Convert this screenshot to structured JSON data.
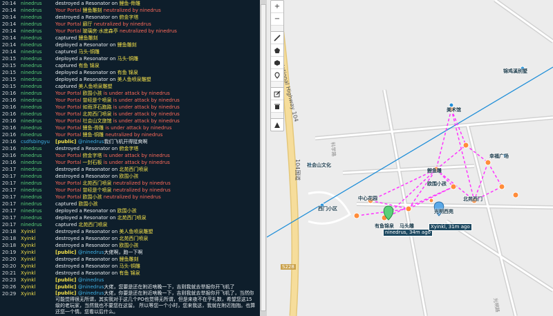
{
  "comm": {
    "rows": [
      {
        "time": "20:14",
        "player": "ninedrus",
        "pcolor": "green",
        "kind": "plain",
        "text": "destroyed a Resonator on ",
        "portal": "鲤鱼-骨雕"
      },
      {
        "time": "20:14",
        "player": "ninedrus",
        "pcolor": "green",
        "kind": "red",
        "text": "Your Portal ",
        "portal": "鲤鱼雕刻",
        "tail": " neutralized by ninedrus"
      },
      {
        "time": "20:14",
        "player": "ninedrus",
        "pcolor": "green",
        "kind": "plain",
        "text": "destroyed a Resonator on ",
        "portal": "俯金字塔"
      },
      {
        "time": "20:14",
        "player": "ninedrus",
        "pcolor": "green",
        "kind": "red",
        "text": "Your Portal ",
        "portal": "廊厅",
        "tail": " neutralized by ninedrus"
      },
      {
        "time": "20:14",
        "player": "ninedrus",
        "pcolor": "green",
        "kind": "red",
        "text": "Your Portal ",
        "portal": "玻璃房·水底森亭",
        "tail": " neutralized by ninedrus"
      },
      {
        "time": "20:14",
        "player": "ninedrus",
        "pcolor": "green",
        "kind": "plain",
        "text": "captured ",
        "portal": "鲤鱼雕刻"
      },
      {
        "time": "20:14",
        "player": "ninedrus",
        "pcolor": "green",
        "kind": "plain",
        "text": "deployed a Resonator on ",
        "portal": "鲤鱼雕刻"
      },
      {
        "time": "20:14",
        "player": "ninedrus",
        "pcolor": "green",
        "kind": "plain",
        "text": "captured ",
        "portal": "马头-铜雕"
      },
      {
        "time": "20:15",
        "player": "ninedrus",
        "pcolor": "green",
        "kind": "plain",
        "text": "deployed a Resonator on ",
        "portal": "马头-铜雕"
      },
      {
        "time": "20:15",
        "player": "ninedrus",
        "pcolor": "green",
        "kind": "plain",
        "text": "captured ",
        "portal": "有鱼 锦泉"
      },
      {
        "time": "20:15",
        "player": "ninedrus",
        "pcolor": "green",
        "kind": "plain",
        "text": "deployed a Resonator on ",
        "portal": "有鱼 锦泉"
      },
      {
        "time": "20:15",
        "player": "ninedrus",
        "pcolor": "green",
        "kind": "plain",
        "text": "deployed a Resonator on ",
        "portal": "美人鱼喷泉雕塑"
      },
      {
        "time": "20:15",
        "player": "ninedrus",
        "pcolor": "green",
        "kind": "plain",
        "text": "captured ",
        "portal": "美人鱼喷泉雕塑"
      },
      {
        "time": "20:16",
        "player": "ninedrus",
        "pcolor": "green",
        "kind": "red",
        "text": "Your Portal ",
        "portal": "欧围小孩",
        "tail": " is under attack by ninedrus"
      },
      {
        "time": "20:16",
        "player": "ninedrus",
        "pcolor": "green",
        "kind": "red",
        "text": "Your Portal ",
        "portal": "曾经是个喷泉",
        "tail": " is under attack by ninedrus"
      },
      {
        "time": "20:16",
        "player": "ninedrus",
        "pcolor": "green",
        "kind": "red",
        "text": "Your Portal ",
        "portal": "如雨浮石跑路",
        "tail": " is under attack by ninedrus"
      },
      {
        "time": "20:16",
        "player": "ninedrus",
        "pcolor": "green",
        "kind": "red",
        "text": "Your Portal ",
        "portal": "北苑西门喷泉",
        "tail": " is under attack by ninedrus"
      },
      {
        "time": "20:16",
        "player": "ninedrus",
        "pcolor": "green",
        "kind": "red",
        "text": "Your Portal ",
        "portal": "社会山文旅馆",
        "tail": " is under attack by ninedrus"
      },
      {
        "time": "20:16",
        "player": "ninedrus",
        "pcolor": "green",
        "kind": "red",
        "text": "Your Portal ",
        "portal": "鲤鱼-骨雕",
        "tail": " is under attack by ninedrus"
      },
      {
        "time": "20:16",
        "player": "ninedrus",
        "pcolor": "green",
        "kind": "red",
        "text": "Your Portal ",
        "portal": "鲤鱼-铜雕",
        "tail": " neutralized by ninedrus"
      },
      {
        "time": "20:16",
        "player": "csdfsbingyu",
        "pcolor": "blue",
        "kind": "public",
        "text": "我们飞机开得挺爽啊",
        "at": "@ninedrus"
      },
      {
        "time": "20:16",
        "player": "ninedrus",
        "pcolor": "green",
        "kind": "plain",
        "text": "destroyed a Resonator on ",
        "portal": "俯金字塔"
      },
      {
        "time": "20:16",
        "player": "ninedrus",
        "pcolor": "green",
        "kind": "red",
        "text": "Your Portal ",
        "portal": "俯金字塔",
        "tail": " is under attack by ninedrus"
      },
      {
        "time": "20:16",
        "player": "ninedrus",
        "pcolor": "green",
        "kind": "red",
        "text": "Your Portal ",
        "portal": "一封石板",
        "tail": " is under attack by ninedrus"
      },
      {
        "time": "20:17",
        "player": "ninedrus",
        "pcolor": "green",
        "kind": "plain",
        "text": "destroyed a Resonator on ",
        "portal": "北苑西门喷泉"
      },
      {
        "time": "20:17",
        "player": "ninedrus",
        "pcolor": "green",
        "kind": "plain",
        "text": "destroyed a Resonator on ",
        "portal": "欧围小孩"
      },
      {
        "time": "20:17",
        "player": "ninedrus",
        "pcolor": "green",
        "kind": "red",
        "text": "Your Portal ",
        "portal": "北苑西门喷泉",
        "tail": " neutralized by ninedrus"
      },
      {
        "time": "20:17",
        "player": "ninedrus",
        "pcolor": "green",
        "kind": "red",
        "text": "Your Portal ",
        "portal": "曾经是个喷泉",
        "tail": " neutralized by ninedrus"
      },
      {
        "time": "20:17",
        "player": "ninedrus",
        "pcolor": "green",
        "kind": "red",
        "text": "Your Portal ",
        "portal": "欧围小孩",
        "tail": " neutralized by ninedrus"
      },
      {
        "time": "20:17",
        "player": "ninedrus",
        "pcolor": "green",
        "kind": "plain",
        "text": "captured ",
        "portal": "欧围小孩"
      },
      {
        "time": "20:17",
        "player": "ninedrus",
        "pcolor": "green",
        "kind": "plain",
        "text": "deployed a Resonator on ",
        "portal": "欧围小孩"
      },
      {
        "time": "20:17",
        "player": "ninedrus",
        "pcolor": "green",
        "kind": "plain",
        "text": "deployed a Resonator on ",
        "portal": "北苑西门喷泉"
      },
      {
        "time": "20:17",
        "player": "ninedrus",
        "pcolor": "green",
        "kind": "plain",
        "text": "captured ",
        "portal": "北苑西门喷泉"
      },
      {
        "time": "20:18",
        "player": "Xyinkl",
        "pcolor": "yellow",
        "kind": "plain",
        "text": "destroyed a Resonator on ",
        "portal": "美人鱼喷泉雕塑"
      },
      {
        "time": "20:18",
        "player": "Xyinkl",
        "pcolor": "yellow",
        "kind": "plain",
        "text": "destroyed a Resonator on ",
        "portal": "北苑西门喷泉"
      },
      {
        "time": "20:18",
        "player": "Xyinkl",
        "pcolor": "yellow",
        "kind": "plain",
        "text": "destroyed a Resonator on ",
        "portal": "欧围小孩"
      },
      {
        "time": "20:19",
        "player": "Xyinkl",
        "pcolor": "yellow",
        "kind": "public",
        "text": "大佬啊，跑一下啊",
        "at": "@ninedrus"
      },
      {
        "time": "20:20",
        "player": "Xyinkl",
        "pcolor": "yellow",
        "kind": "plain",
        "text": "destroyed a Resonator on ",
        "portal": "鲤鱼雕刻"
      },
      {
        "time": "20:20",
        "player": "Xyinkl",
        "pcolor": "yellow",
        "kind": "plain",
        "text": "destroyed a Resonator on ",
        "portal": "马头-铜雕"
      },
      {
        "time": "20:21",
        "player": "Xyinkl",
        "pcolor": "yellow",
        "kind": "plain",
        "text": "destroyed a Resonator on ",
        "portal": "有鱼 锦泉"
      },
      {
        "time": "20:23",
        "player": "Xyinkl",
        "pcolor": "yellow",
        "kind": "public",
        "text": "",
        "at": "@ninedrus"
      },
      {
        "time": "20:26",
        "player": "Xyinkl",
        "pcolor": "yellow",
        "kind": "public",
        "text": "大佬，您要是还在附近啥晚一下，吉则我就去举报你开飞机了",
        "at": "@ninedrus"
      },
      {
        "time": "20:29",
        "player": "Xyinkl",
        "pcolor": "yellow",
        "kind": "publicwrap",
        "text": "大佬，你要是还在附近啥晚一下，吉则我就去举报你开飞机了，当然你可能觉得很无所谓，其实我对于这几个PO也觉得无所谓，但是来夜不在乎礼数，希望您这15级的老玩家，当然我也不要您在这留。 所以等您一个小时，您来我这，我就在附近抱抱。也算还您一个情。您看以后什么。",
        "at": "@ninedrus"
      }
    ]
  },
  "map": {
    "road_label": "Tuma National Highway 104",
    "road_side_label": "104国道",
    "road_badge": "S228",
    "street_label_1": "科学路",
    "street_label_2": "光明路",
    "place_labels": [
      "锦鸡溪别墅",
      "社会山文化",
      "西门小区",
      "光明西苑",
      "美术馆",
      "鲤鱼雕",
      "幸福广场",
      "北苑西门",
      "中心花园",
      "马头雕",
      "有鱼锦泉",
      "欧围小孩"
    ],
    "agent_labels": [
      "ninedrus, 34m ago",
      "Xyinkl, 31m ago"
    ]
  },
  "toolbar": {
    "zoom_in": "+",
    "zoom_out": "−",
    "tools": [
      "polyline-icon",
      "polygon-icon",
      "circle-icon",
      "marker-icon",
      "edit-icon",
      "delete-icon",
      "locate-icon"
    ]
  },
  "colors": {
    "chat_bg": "#0e1e2b",
    "player_green": "#5ad07a",
    "player_yellow": "#f3e04a",
    "player_blue": "#3fb3e8",
    "alert_red": "#ff6a5a",
    "link_magenta": "#ff33ff",
    "road_yellow": "#f6dd9b"
  }
}
